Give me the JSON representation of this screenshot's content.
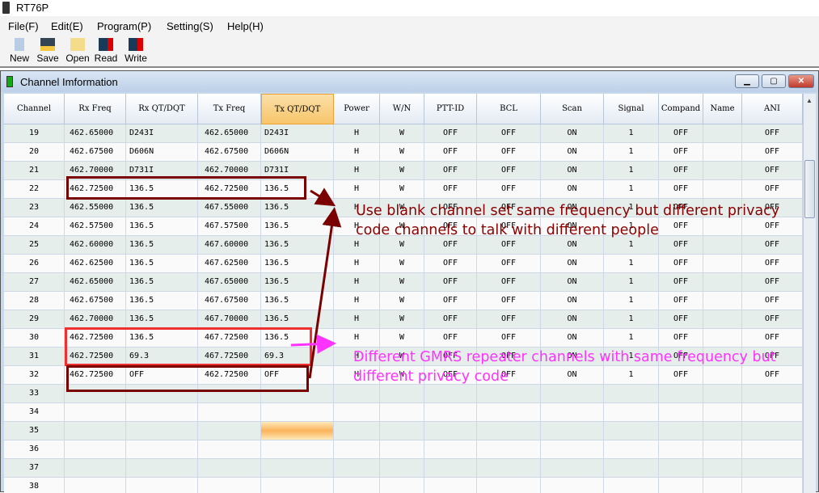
{
  "app": {
    "title": "RT76P"
  },
  "menu": [
    "File(F)",
    "Edit(E)",
    "Program(P)",
    "Setting(S)",
    "Help(H)"
  ],
  "toolbar": [
    {
      "label": "New",
      "icon": "new-file-icon"
    },
    {
      "label": "Save",
      "icon": "save-icon"
    },
    {
      "label": "Open",
      "icon": "folder-open-icon"
    },
    {
      "label": "Read",
      "icon": "read-radio-icon"
    },
    {
      "label": "Write",
      "icon": "write-radio-icon"
    }
  ],
  "window": {
    "title": "Channel Imformation"
  },
  "columns": [
    "Channel",
    "Rx Freq",
    "Rx QT/DQT",
    "Tx Freq",
    "Tx QT/DQT",
    "Power",
    "W/N",
    "PTT-ID",
    "BCL",
    "Scan",
    "Signal",
    "Compand",
    "Name",
    "ANI"
  ],
  "selected_column": "Tx QT/DQT",
  "rows": [
    [
      "19",
      "462.65000",
      "D243I",
      "462.65000",
      "D243I",
      "H",
      "W",
      "OFF",
      "OFF",
      "ON",
      "1",
      "OFF",
      "",
      "OFF"
    ],
    [
      "20",
      "462.67500",
      "D606N",
      "462.67500",
      "D606N",
      "H",
      "W",
      "OFF",
      "OFF",
      "ON",
      "1",
      "OFF",
      "",
      "OFF"
    ],
    [
      "21",
      "462.70000",
      "D731I",
      "462.70000",
      "D731I",
      "H",
      "W",
      "OFF",
      "OFF",
      "ON",
      "1",
      "OFF",
      "",
      "OFF"
    ],
    [
      "22",
      "462.72500",
      "136.5",
      "462.72500",
      "136.5",
      "H",
      "W",
      "OFF",
      "OFF",
      "ON",
      "1",
      "OFF",
      "",
      "OFF"
    ],
    [
      "23",
      "462.55000",
      "136.5",
      "467.55000",
      "136.5",
      "H",
      "W",
      "OFF",
      "OFF",
      "ON",
      "1",
      "OFF",
      "",
      "OFF"
    ],
    [
      "24",
      "462.57500",
      "136.5",
      "467.57500",
      "136.5",
      "H",
      "W",
      "OFF",
      "OFF",
      "ON",
      "1",
      "OFF",
      "",
      "OFF"
    ],
    [
      "25",
      "462.60000",
      "136.5",
      "467.60000",
      "136.5",
      "H",
      "W",
      "OFF",
      "OFF",
      "ON",
      "1",
      "OFF",
      "",
      "OFF"
    ],
    [
      "26",
      "462.62500",
      "136.5",
      "467.62500",
      "136.5",
      "H",
      "W",
      "OFF",
      "OFF",
      "ON",
      "1",
      "OFF",
      "",
      "OFF"
    ],
    [
      "27",
      "462.65000",
      "136.5",
      "467.65000",
      "136.5",
      "H",
      "W",
      "OFF",
      "OFF",
      "ON",
      "1",
      "OFF",
      "",
      "OFF"
    ],
    [
      "28",
      "462.67500",
      "136.5",
      "467.67500",
      "136.5",
      "H",
      "W",
      "OFF",
      "OFF",
      "ON",
      "1",
      "OFF",
      "",
      "OFF"
    ],
    [
      "29",
      "462.70000",
      "136.5",
      "467.70000",
      "136.5",
      "H",
      "W",
      "OFF",
      "OFF",
      "ON",
      "1",
      "OFF",
      "",
      "OFF"
    ],
    [
      "30",
      "462.72500",
      "136.5",
      "467.72500",
      "136.5",
      "H",
      "W",
      "OFF",
      "OFF",
      "ON",
      "1",
      "OFF",
      "",
      "OFF"
    ],
    [
      "31",
      "462.72500",
      "69.3",
      "467.72500",
      "69.3",
      "H",
      "W",
      "OFF",
      "OFF",
      "ON",
      "1",
      "OFF",
      "",
      "OFF"
    ],
    [
      "32",
      "462.72500",
      "OFF",
      "462.72500",
      "OFF",
      "H",
      "W",
      "OFF",
      "OFF",
      "ON",
      "1",
      "OFF",
      "",
      "OFF"
    ],
    [
      "33",
      "",
      "",
      "",
      "",
      "",
      "",
      "",
      "",
      "",
      "",
      "",
      "",
      ""
    ],
    [
      "34",
      "",
      "",
      "",
      "",
      "",
      "",
      "",
      "",
      "",
      "",
      "",
      "",
      ""
    ],
    [
      "35",
      "",
      "",
      "",
      "",
      "",
      "",
      "",
      "",
      "",
      "",
      "",
      "",
      ""
    ],
    [
      "36",
      "",
      "",
      "",
      "",
      "",
      "",
      "",
      "",
      "",
      "",
      "",
      "",
      ""
    ],
    [
      "37",
      "",
      "",
      "",
      "",
      "",
      "",
      "",
      "",
      "",
      "",
      "",
      "",
      ""
    ],
    [
      "38",
      "",
      "",
      "",
      "",
      "",
      "",
      "",
      "",
      "",
      "",
      "",
      "",
      ""
    ]
  ],
  "selected_cell": {
    "channel": "35",
    "column": "Tx QT/DQT"
  },
  "annotations": {
    "note1": {
      "line1": "Use blank channel set same frequency but different privacy",
      "line2": "code channels to talk with different people",
      "color": "#8b0000"
    },
    "note2": {
      "line1": "Different GMRS repeater channels with same frequency but",
      "line2": "different privacy code",
      "color": "#ff33ff"
    },
    "box_colors": {
      "dark": "#7a0000",
      "red": "#f03030"
    }
  }
}
